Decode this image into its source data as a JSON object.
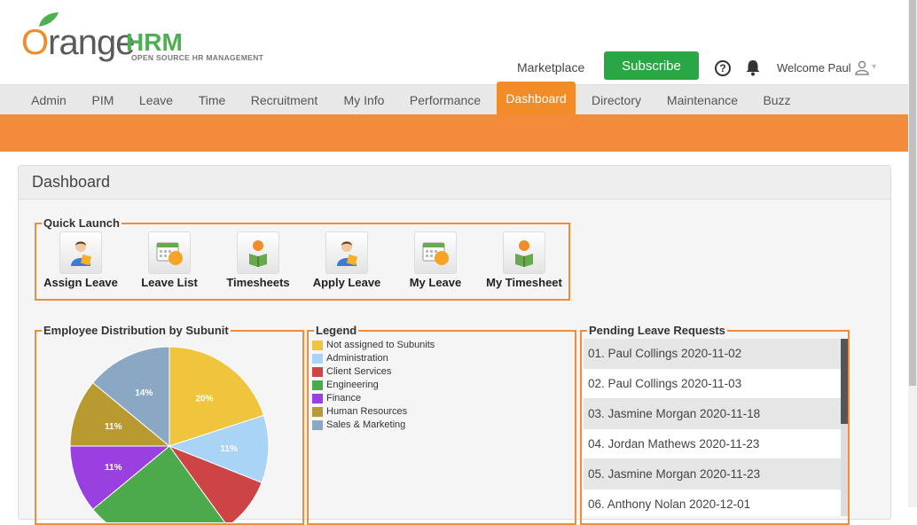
{
  "brand": {
    "word_o": "O",
    "word_rest": "range",
    "hrm": "HRM",
    "tagline": "OPEN SOURCE HR MANAGEMENT"
  },
  "header": {
    "marketplace": "Marketplace",
    "subscribe": "Subscribe",
    "help_glyph": "?",
    "welcome": "Welcome Paul",
    "caret": "▾"
  },
  "menu": [
    {
      "label": "Admin"
    },
    {
      "label": "PIM"
    },
    {
      "label": "Leave"
    },
    {
      "label": "Time"
    },
    {
      "label": "Recruitment"
    },
    {
      "label": "My Info"
    },
    {
      "label": "Performance"
    },
    {
      "label": "Dashboard",
      "active": true
    },
    {
      "label": "Directory"
    },
    {
      "label": "Maintenance"
    },
    {
      "label": "Buzz"
    }
  ],
  "panel": {
    "title": "Dashboard"
  },
  "quick_launch": {
    "title": "Quick Launch",
    "items": [
      {
        "label": "Assign Leave",
        "icon": "person-leave-icon"
      },
      {
        "label": "Leave List",
        "icon": "calendar-list-icon"
      },
      {
        "label": "Timesheets",
        "icon": "person-book-icon"
      },
      {
        "label": "Apply Leave",
        "icon": "person-leave-icon"
      },
      {
        "label": "My Leave",
        "icon": "calendar-list-icon"
      },
      {
        "label": "My Timesheet",
        "icon": "person-book-icon"
      }
    ]
  },
  "distribution": {
    "title": "Employee Distribution by Subunit"
  },
  "legend": {
    "title": "Legend",
    "items": [
      {
        "label": "Not assigned to Subunits",
        "color": "#f0c43c"
      },
      {
        "label": "Administration",
        "color": "#aad4f5"
      },
      {
        "label": "Client Services",
        "color": "#cc4444"
      },
      {
        "label": "Engineering",
        "color": "#4caa4c"
      },
      {
        "label": "Finance",
        "color": "#9a3fe0"
      },
      {
        "label": "Human Resources",
        "color": "#b89a30"
      },
      {
        "label": "Sales & Marketing",
        "color": "#8aa8c4"
      }
    ]
  },
  "chart_data": {
    "type": "pie",
    "categories": [
      "Not assigned to Subunits",
      "Administration",
      "Client Services",
      "Engineering",
      "Finance",
      "Human Resources",
      "Sales & Marketing"
    ],
    "values": [
      20,
      11,
      9,
      24,
      11,
      11,
      14
    ],
    "labels": [
      "20%",
      "11%",
      "",
      "",
      "11%",
      "11%",
      "14%"
    ],
    "colors": [
      "#f0c43c",
      "#aad4f5",
      "#cc4444",
      "#4caa4c",
      "#9a3fe0",
      "#b89a30",
      "#8aa8c4"
    ]
  },
  "pending": {
    "title": "Pending Leave Requests",
    "items": [
      "01. Paul Collings 2020-11-02",
      "02. Paul Collings 2020-11-03",
      "03. Jasmine Morgan 2020-11-18",
      "04. Jordan Mathews 2020-11-23",
      "05. Jasmine Morgan 2020-11-23",
      "06. Anthony Nolan 2020-12-01"
    ]
  }
}
